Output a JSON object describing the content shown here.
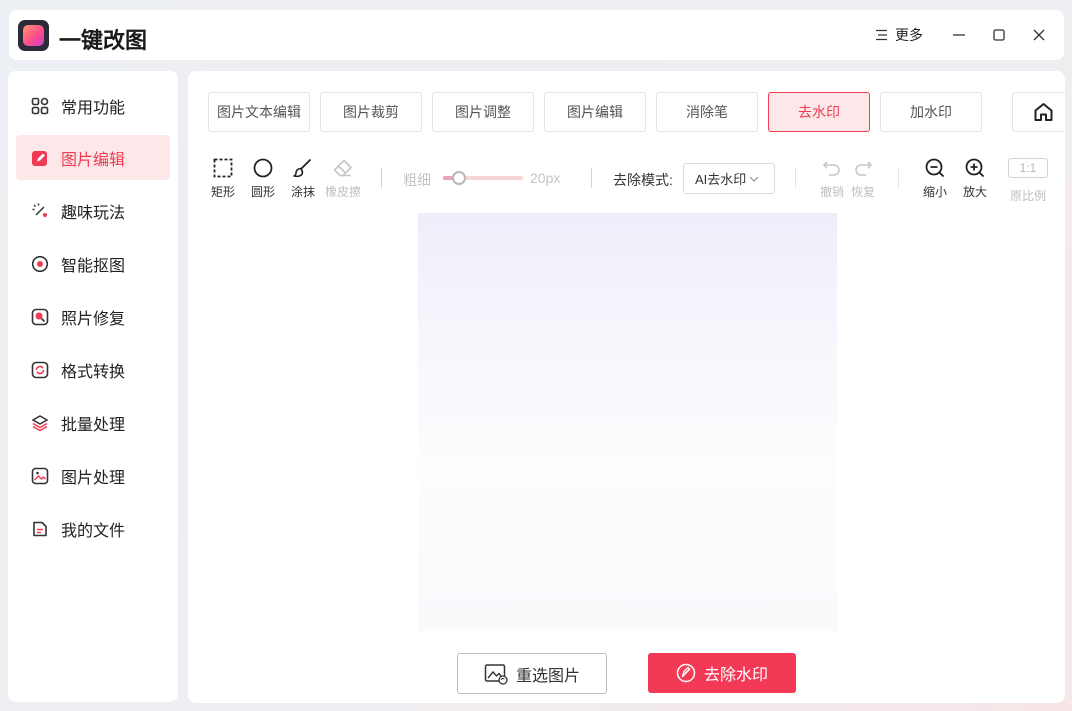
{
  "app": {
    "title": "一键改图",
    "more_label": "更多"
  },
  "sidebar": {
    "items": [
      {
        "label": "常用功能",
        "icon": "grid-icon"
      },
      {
        "label": "图片编辑",
        "icon": "edit-icon",
        "active": true
      },
      {
        "label": "趣味玩法",
        "icon": "magic-wand-icon"
      },
      {
        "label": "智能抠图",
        "icon": "target-icon"
      },
      {
        "label": "照片修复",
        "icon": "photo-repair-icon"
      },
      {
        "label": "格式转换",
        "icon": "convert-icon"
      },
      {
        "label": "批量处理",
        "icon": "layers-icon"
      },
      {
        "label": "图片处理",
        "icon": "image-icon"
      },
      {
        "label": "我的文件",
        "icon": "file-icon"
      }
    ]
  },
  "tabs": [
    {
      "label": "图片文本编辑"
    },
    {
      "label": "图片裁剪"
    },
    {
      "label": "图片调整"
    },
    {
      "label": "图片编辑"
    },
    {
      "label": "消除笔"
    },
    {
      "label": "去水印",
      "active": true
    },
    {
      "label": "加水印"
    }
  ],
  "toolbar": {
    "tools": {
      "rect": "矩形",
      "circle": "圆形",
      "brush": "涂抹",
      "eraser": "橡皮擦"
    },
    "size_label": "粗细",
    "size_value": "20px",
    "size_fraction": 0.2,
    "mode_label": "去除模式:",
    "mode_value": "AI去水印",
    "undo": "撤销",
    "redo": "恢复",
    "zoom_out": "缩小",
    "zoom_in": "放大",
    "ratio_value": "1:1",
    "ratio_label": "原比例"
  },
  "actions": {
    "reselect": "重选图片",
    "remove": "去除水印"
  },
  "colors": {
    "accent": "#f23a57",
    "active_bg": "#fde7e9"
  }
}
